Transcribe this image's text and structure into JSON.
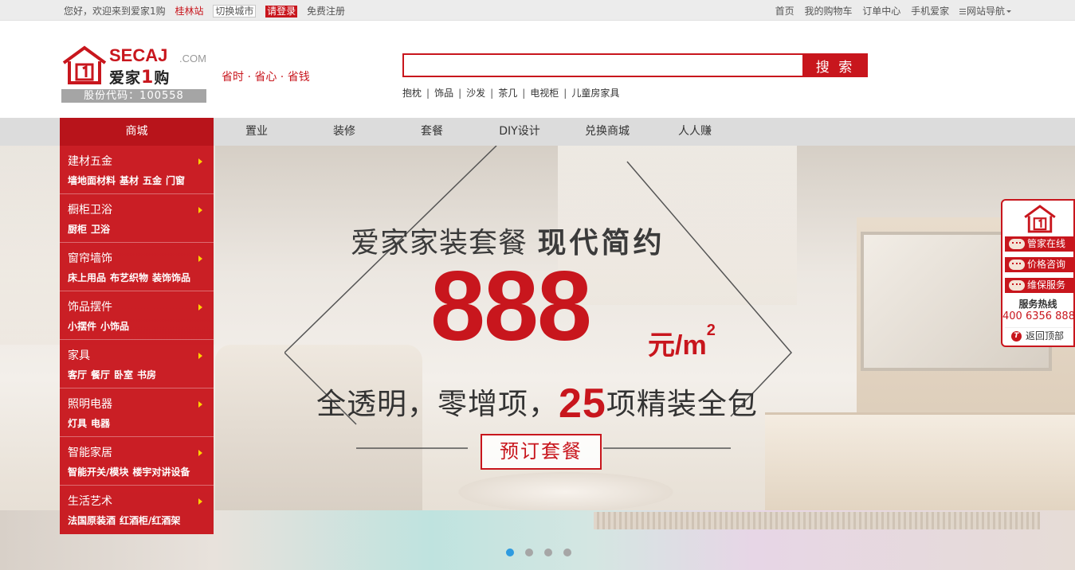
{
  "topbar": {
    "greeting": "您好，欢迎来到爱家1购",
    "city": "桂林站",
    "switch_city": "切换城市",
    "login": "请登录",
    "register": "免费注册",
    "links": [
      "首页",
      "我的购物车",
      "订单中心",
      "手机爱家"
    ],
    "site_nav": "网站导航"
  },
  "logo": {
    "brand_en": "SECAJ",
    "brand_com": ".COM",
    "brand_cn_1": "爱家",
    "brand_cn_one": "1",
    "brand_cn_2": "购",
    "stock": "股份代码：100558"
  },
  "slogan": "省时 · 省心 · 省钱",
  "search": {
    "placeholder": "",
    "button": "搜 索",
    "hotwords": [
      "抱枕",
      "饰品",
      "沙发",
      "茶几",
      "电视柜",
      "儿童房家具"
    ]
  },
  "nav": {
    "category": "商城",
    "items": [
      "置业",
      "装修",
      "套餐",
      "DIY设计",
      "兑换商城",
      "人人赚"
    ]
  },
  "categories": [
    {
      "title": "建材五金",
      "subs": [
        "墙地面材料",
        "基材",
        "五金",
        "门窗"
      ]
    },
    {
      "title": "橱柜卫浴",
      "subs": [
        "厨柜",
        "卫浴"
      ]
    },
    {
      "title": "窗帘墙饰",
      "subs": [
        "床上用品",
        "布艺织物",
        "装饰饰品"
      ]
    },
    {
      "title": "饰品摆件",
      "subs": [
        "小摆件",
        "小饰品"
      ]
    },
    {
      "title": "家具",
      "subs": [
        "客厅",
        "餐厅",
        "卧室",
        "书房"
      ]
    },
    {
      "title": "照明电器",
      "subs": [
        "灯具",
        "电器"
      ]
    },
    {
      "title": "智能家居",
      "subs": [
        "智能开关/模块",
        "楼宇对讲设备"
      ]
    },
    {
      "title": "生活艺术",
      "subs": [
        "法国原装酒",
        "红酒柜/红酒架"
      ]
    }
  ],
  "banner": {
    "headline_1": "爱家家装套餐",
    "headline_2": "现代简约",
    "price": "888",
    "unit": "元/m",
    "unit_sup": "2",
    "sub_1": "全透明，零增项，",
    "sub_num": "25",
    "sub_2": "项精装全包",
    "button": "预订套餐",
    "dots": 4,
    "active_dot": 0
  },
  "service": {
    "btn_1": "管家在线",
    "btn_2": "价格咨询",
    "btn_3": "维保服务",
    "hotline_title": "服务热线",
    "hotline": "400 6356 888",
    "back_top": "返回顶部"
  },
  "colors": {
    "brand_red": "#c8161d",
    "nav_gray": "#dcdcdc",
    "dot_active": "#2e9be0"
  }
}
